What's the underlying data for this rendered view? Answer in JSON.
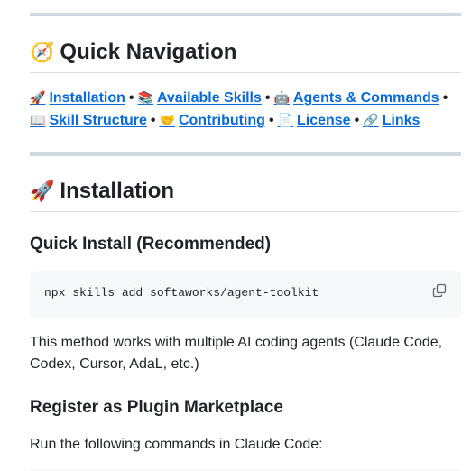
{
  "quick_nav": {
    "icon": "compass",
    "heading": "Quick Navigation",
    "links": [
      {
        "icon": "rocket",
        "label": "Installation"
      },
      {
        "icon": "books",
        "label": "Available Skills"
      },
      {
        "icon": "robot",
        "label": "Agents & Commands"
      },
      {
        "icon": "open-book",
        "label": "Skill Structure"
      },
      {
        "icon": "handshake",
        "label": "Contributing"
      },
      {
        "icon": "page",
        "label": "License"
      },
      {
        "icon": "link",
        "label": "Links"
      }
    ],
    "separator": "•"
  },
  "installation": {
    "icon": "rocket",
    "heading": "Installation",
    "quick_install": {
      "heading": "Quick Install (Recommended)",
      "command": "npx skills add softaworks/agent-toolkit",
      "description": "This method works with multiple AI coding agents (Claude Code, Codex, Cursor, AdaL, etc.)"
    },
    "marketplace": {
      "heading": "Register as Plugin Marketplace",
      "description": "Run the following commands in Claude Code:"
    }
  },
  "colors": {
    "link": "#0969da",
    "text": "#1f2328",
    "code_bg": "#f6f8fa",
    "rule": "#d1d9e0"
  }
}
